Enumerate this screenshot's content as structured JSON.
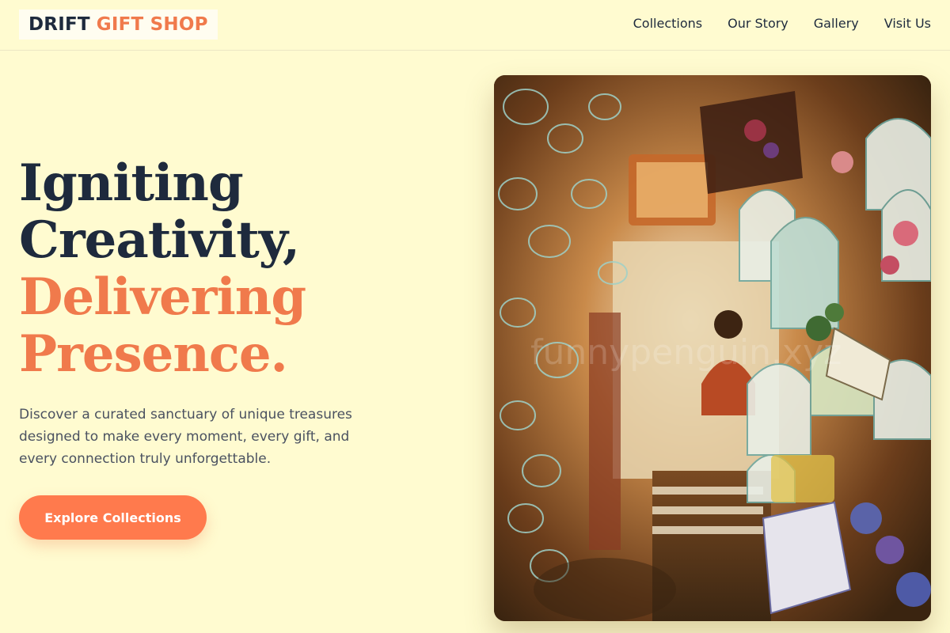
{
  "brand": {
    "name_dark": "DRIFT",
    "name_accent": "GIFT SHOP"
  },
  "nav": {
    "items": [
      {
        "label": "Collections"
      },
      {
        "label": "Our Story"
      },
      {
        "label": "Gallery"
      },
      {
        "label": "Visit Us"
      }
    ]
  },
  "hero": {
    "headline": {
      "line1": "Igniting",
      "line2": "Creativity,",
      "line3": "Delivering",
      "line4": "Presence."
    },
    "description": "Discover a curated sanctuary of unique treasures designed to make every moment, every gift, and every connection truly unforgettable.",
    "cta_label": "Explore Collections",
    "image": {
      "watermark": "funnypenguin.xyz"
    }
  },
  "colors": {
    "background": "#fffbd0",
    "accent": "#f07a4c",
    "text_dark": "#1e2a3d",
    "text_muted": "#4a5160",
    "button": "#ff7a4d"
  }
}
